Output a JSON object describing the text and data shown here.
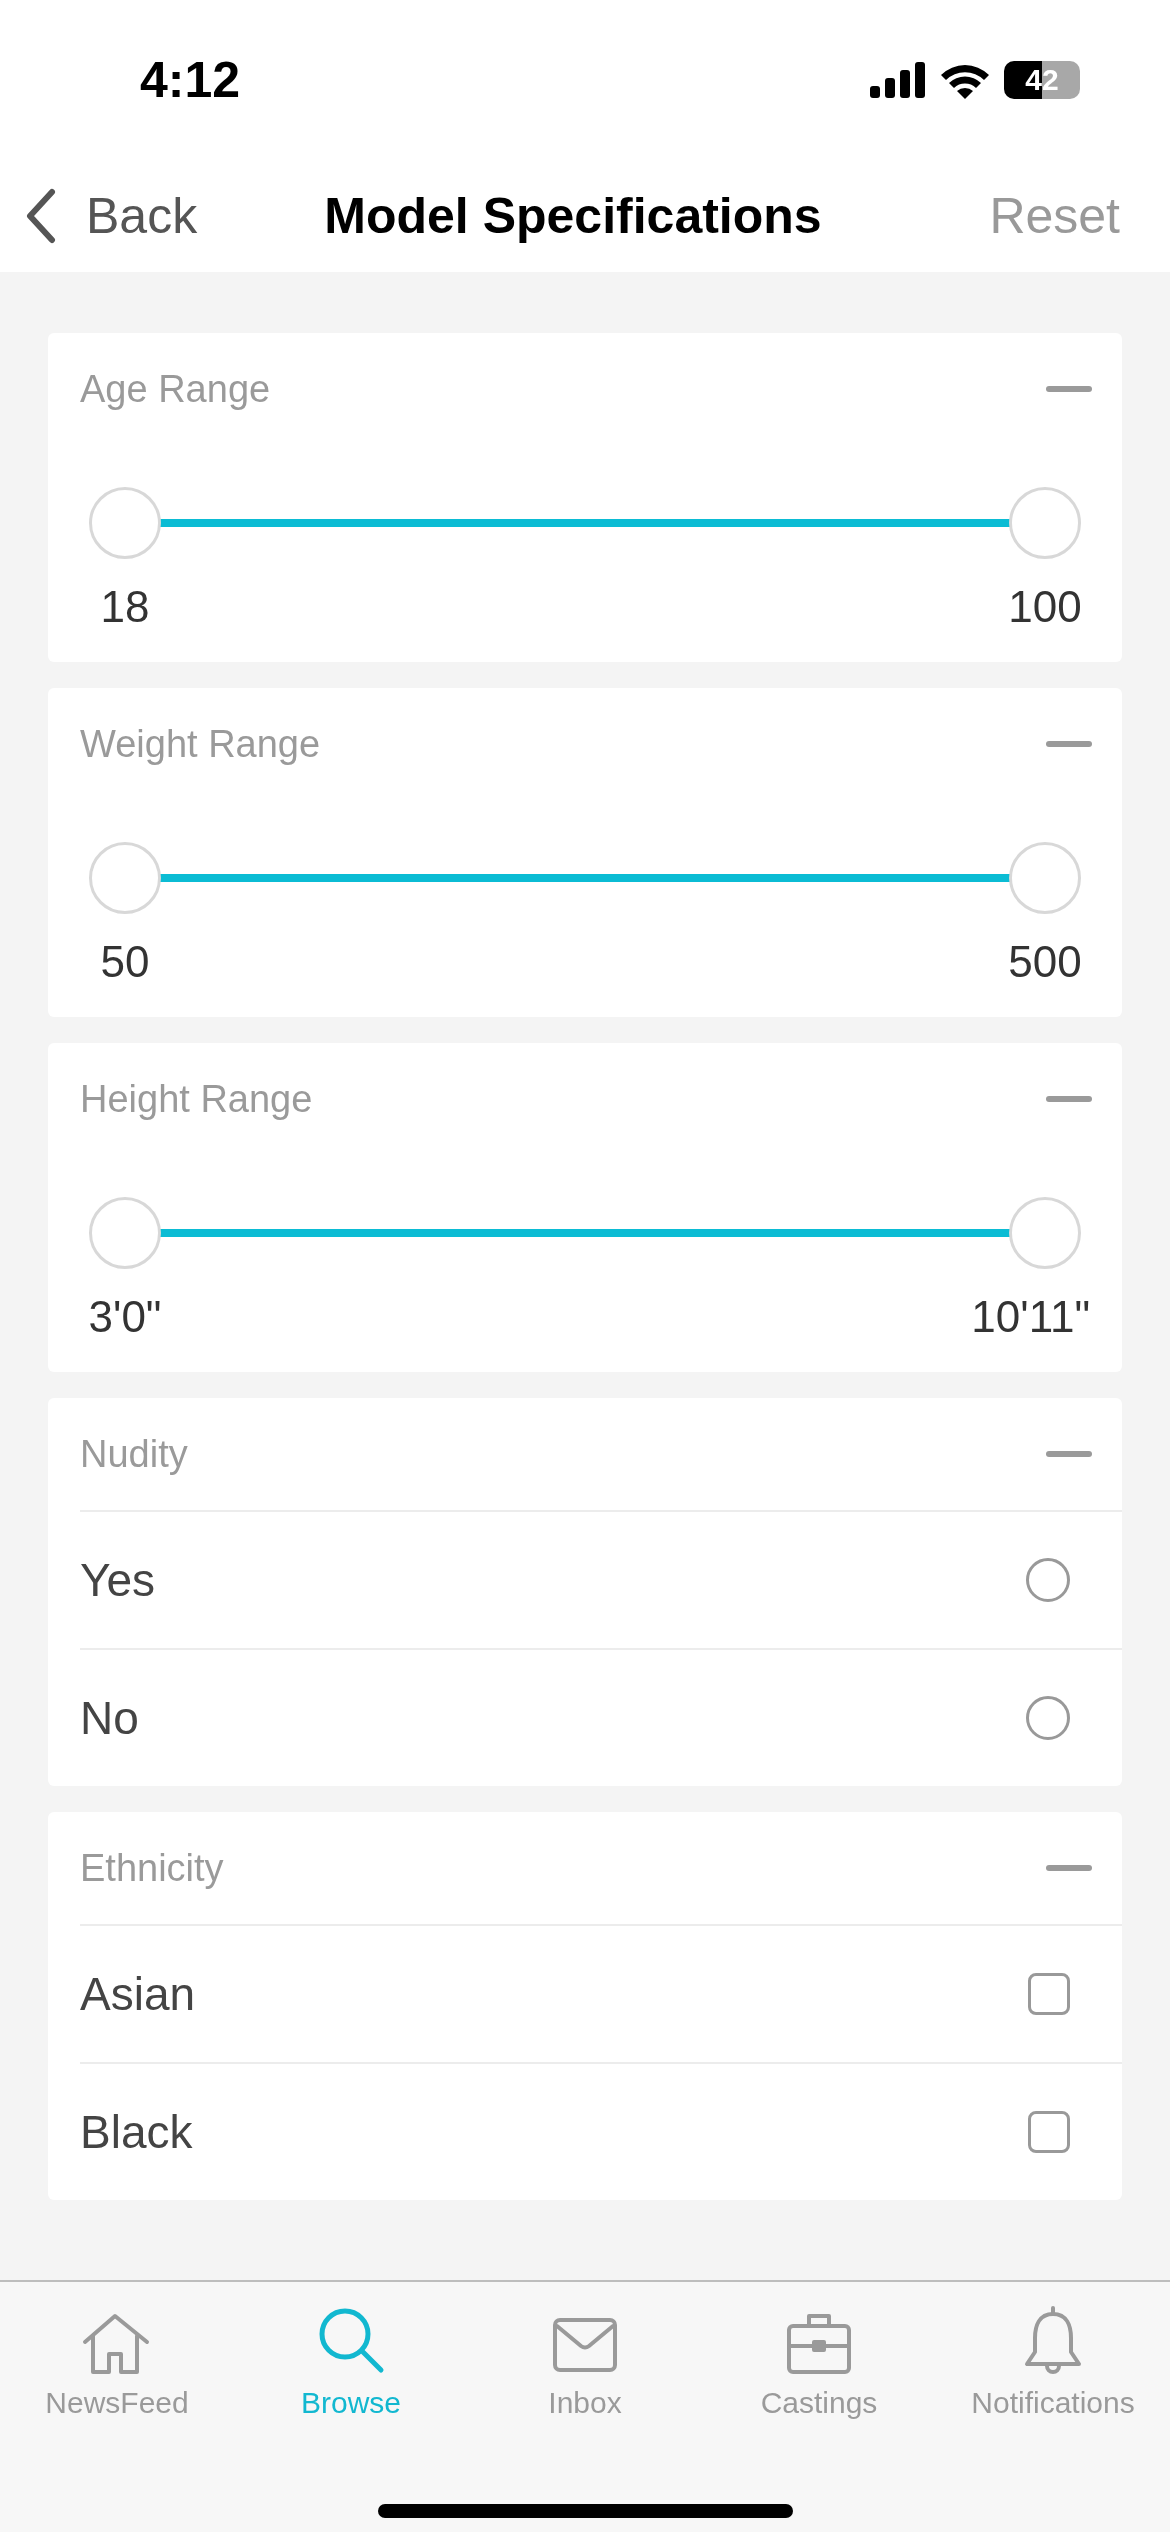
{
  "status_bar": {
    "time": "4:12",
    "battery": "42"
  },
  "nav": {
    "back": "Back",
    "title": "Model Specifications",
    "reset": "Reset"
  },
  "sections": [
    {
      "kind": "range",
      "title": "Age Range",
      "expanded": true,
      "min_label": "18",
      "max_label": "100",
      "thumbs": [
        {
          "level": 0
        },
        {
          "level": 1
        }
      ]
    },
    {
      "kind": "range",
      "title": "Weight Range",
      "expanded": true,
      "min_label": "50",
      "max_label": "500",
      "thumbs": [
        {
          "level": 0
        },
        {
          "level": 1
        }
      ]
    },
    {
      "kind": "range",
      "title": "Height Range",
      "expanded": true,
      "min_label": "3'0\"",
      "max_label": "10'11\"",
      "thumbs": [
        {
          "level": 0
        },
        {
          "level": 1
        }
      ]
    },
    {
      "kind": "radio",
      "title": "Nudity",
      "expanded": true,
      "options": [
        {
          "label": "Yes",
          "selected": false
        },
        {
          "label": "No",
          "selected": false
        }
      ]
    },
    {
      "kind": "checkbox",
      "title": "Ethnicity",
      "expanded": true,
      "options": [
        {
          "label": "Asian",
          "checked": false
        },
        {
          "label": "Black",
          "checked": false
        }
      ]
    }
  ],
  "tabs": [
    {
      "label": "NewsFeed",
      "selected": false
    },
    {
      "label": "Browse",
      "selected": true
    },
    {
      "label": "Inbox",
      "selected": false
    },
    {
      "label": "Castings",
      "selected": false
    },
    {
      "label": "Notifications",
      "selected": false
    }
  ]
}
